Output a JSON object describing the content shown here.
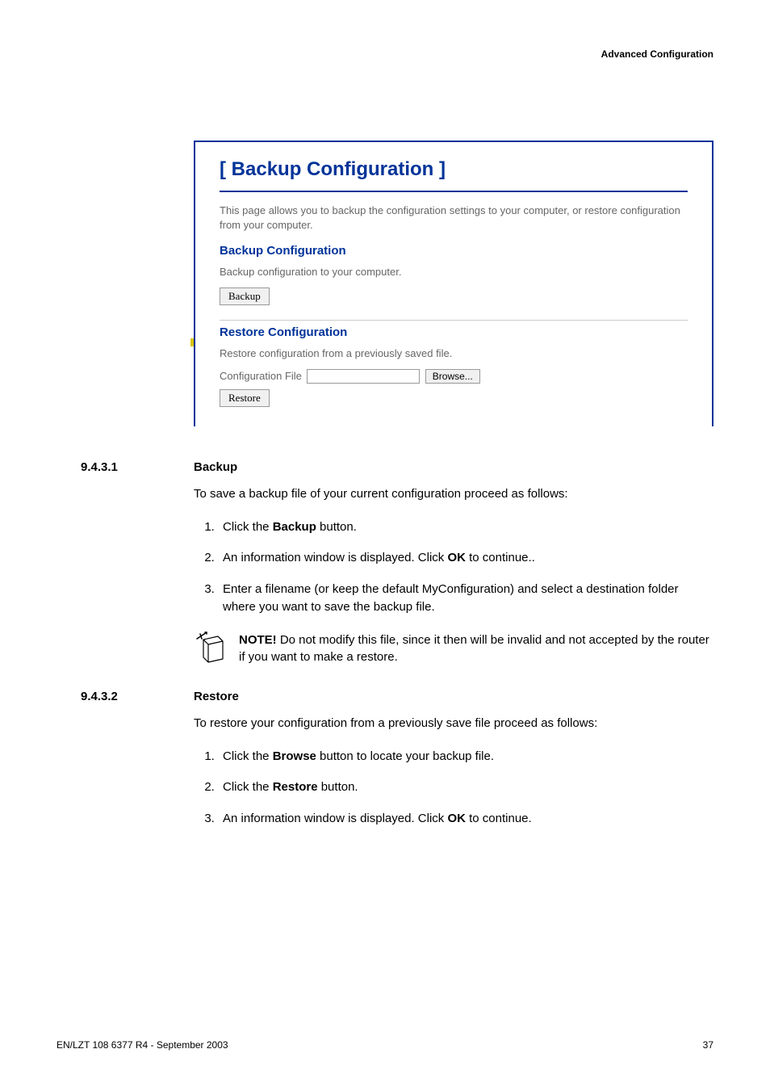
{
  "header": {
    "right": "Advanced Configuration"
  },
  "screenshot": {
    "title": "[ Backup Configuration ]",
    "intro": "This page allows you to backup the configuration settings to your computer, or restore configuration from your computer.",
    "backup": {
      "heading": "Backup Configuration",
      "desc": "Backup configuration to your computer.",
      "button": "Backup"
    },
    "restore": {
      "heading": "Restore Configuration",
      "desc": "Restore configuration from a previously saved file.",
      "label": "Configuration File",
      "browse": "Browse...",
      "button": "Restore"
    }
  },
  "section1": {
    "number": "9.4.3.1",
    "title": "Backup",
    "intro": "To save a backup file of your current configuration proceed as follows:",
    "steps": {
      "s1a": "Click the ",
      "s1b": "Backup",
      "s1c": " button.",
      "s2a": "An information window is displayed. Click ",
      "s2b": "OK",
      "s2c": " to continue..",
      "s3": "Enter a filename (or keep the default MyConfiguration) and select a destination folder where you want to save the backup file."
    },
    "note": {
      "bold": "NOTE!",
      "text": " Do not modify this file, since it then will be invalid and not accepted by the router if you want to make a restore."
    }
  },
  "section2": {
    "number": "9.4.3.2",
    "title": "Restore",
    "intro": "To restore your configuration from a previously save file proceed as follows:",
    "steps": {
      "s1a": "Click the ",
      "s1b": "Browse",
      "s1c": " button to locate your backup file.",
      "s2a": "Click the ",
      "s2b": "Restore",
      "s2c": " button.",
      "s3a": "An information window is displayed. Click ",
      "s3b": "OK",
      "s3c": " to continue."
    }
  },
  "footer": {
    "left": "EN/LZT 108 6377 R4 - September 2003",
    "right": "37"
  }
}
